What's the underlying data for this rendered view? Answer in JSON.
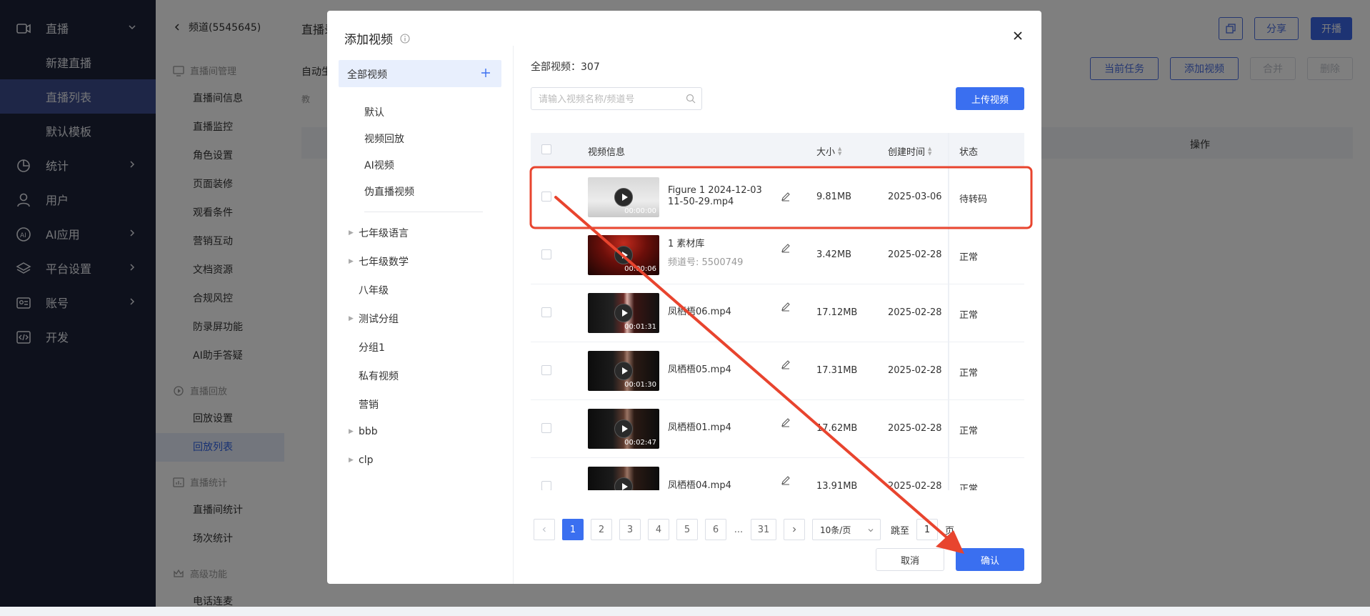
{
  "sidebar": {
    "items": [
      {
        "label": "直播",
        "icon": "video-camera-icon",
        "chevron": "down"
      },
      {
        "label": "新建直播",
        "sub": true
      },
      {
        "label": "直播列表",
        "sub": true,
        "active": true
      },
      {
        "label": "默认模板",
        "sub": true
      },
      {
        "label": "统计",
        "icon": "stats-icon",
        "chevron": "right"
      },
      {
        "label": "用户",
        "icon": "user-icon",
        "chevron": ""
      },
      {
        "label": "AI应用",
        "icon": "ai-icon",
        "chevron": "right"
      },
      {
        "label": "平台设置",
        "icon": "layers-icon",
        "chevron": "right"
      },
      {
        "label": "账号",
        "icon": "id-card-icon",
        "chevron": "right"
      },
      {
        "label": "开发",
        "icon": "code-icon",
        "chevron": ""
      }
    ]
  },
  "submenu": {
    "back_label": "频道(5545645)",
    "groups": [
      {
        "title": "直播间管理",
        "icon": "monitor-icon",
        "items": [
          "直播间信息",
          "直播监控",
          "角色设置",
          "页面装修",
          "观看条件",
          "营销互动",
          "文档资源",
          "合规风控",
          "防录屏功能",
          "AI助手答疑"
        ]
      },
      {
        "title": "直播回放",
        "icon": "replay-icon",
        "items": [
          "回放设置",
          "回放列表"
        ]
      },
      {
        "title": "直播统计",
        "icon": "chart-icon",
        "items": [
          "直播间统计",
          "场次统计"
        ]
      },
      {
        "title": "高级功能",
        "icon": "crown-icon",
        "items": [
          "电话连麦"
        ]
      }
    ],
    "active_item": "回放列表"
  },
  "main": {
    "title": "直播录",
    "auto_label": "自动生",
    "info": "教",
    "buttons": {
      "copy_icon": "copy-icon",
      "share": "分享",
      "start": "开播",
      "current_task": "当前任务",
      "add_video": "添加视频",
      "merge": "合并",
      "delete": "删除"
    },
    "op_header": "操作"
  },
  "modal": {
    "title": "添加视频",
    "all_videos": "全部视频",
    "categories": [
      {
        "label": "默认",
        "type": "item"
      },
      {
        "label": "视频回放",
        "type": "item"
      },
      {
        "label": "AI视频",
        "type": "item"
      },
      {
        "label": "伪直播视频",
        "type": "item"
      }
    ],
    "groups": [
      {
        "label": "七年级语言",
        "expandable": true
      },
      {
        "label": "七年级数学",
        "expandable": true
      },
      {
        "label": "八年级",
        "expandable": false
      },
      {
        "label": "测试分组",
        "expandable": true
      },
      {
        "label": "分组1",
        "expandable": false
      },
      {
        "label": "私有视频",
        "expandable": false
      },
      {
        "label": "营销",
        "expandable": false
      },
      {
        "label": "bbb",
        "expandable": true
      },
      {
        "label": "clp",
        "expandable": true
      }
    ],
    "total_label": "全部视频：",
    "total_count": "307",
    "search_placeholder": "请输入视频名称/频道号",
    "upload_label": "上传视频",
    "columns": {
      "info": "视频信息",
      "size": "大小",
      "created": "创建时间",
      "status": "状态"
    },
    "rows": [
      {
        "name": "Figure 1 2024-12-03 11-50-29.mp4",
        "sub": "",
        "duration": "00:00:00",
        "size": "9.81MB",
        "created": "2025-03-06",
        "status": "待转码",
        "thumb": "light"
      },
      {
        "name": "1 素材库",
        "sub": "频道号: 5500749",
        "duration": "00:00:06",
        "size": "3.42MB",
        "created": "2025-02-28",
        "status": "正常",
        "thumb": "stage"
      },
      {
        "name": "凤栖梧06.mp4",
        "sub": "",
        "duration": "00:01:31",
        "size": "17.12MB",
        "created": "2025-02-28",
        "status": "正常",
        "thumb": "dark-red"
      },
      {
        "name": "凤栖梧05.mp4",
        "sub": "",
        "duration": "00:01:30",
        "size": "17.31MB",
        "created": "2025-02-28",
        "status": "正常",
        "thumb": "dark"
      },
      {
        "name": "凤栖梧01.mp4",
        "sub": "",
        "duration": "00:02:47",
        "size": "17.62MB",
        "created": "2025-02-28",
        "status": "正常",
        "thumb": "dark"
      },
      {
        "name": "凤栖梧04.mp4",
        "sub": "",
        "duration": "",
        "size": "13.91MB",
        "created": "2025-02-28",
        "status": "正常",
        "thumb": "dark"
      }
    ],
    "pagination": {
      "pages": [
        "1",
        "2",
        "3",
        "4",
        "5",
        "6"
      ],
      "ellipsis": "...",
      "last_page": "31",
      "current": "1",
      "page_size": "10条/页",
      "jump_label": "跳至",
      "jump_value": "1",
      "page_unit": "页"
    },
    "cancel_label": "取消",
    "confirm_label": "确认"
  },
  "colors": {
    "sidebar_bg": "#1d2339",
    "sidebar_active": "#3c4c8e",
    "primary": "#3a6ff0",
    "annotation": "#e8442e"
  }
}
